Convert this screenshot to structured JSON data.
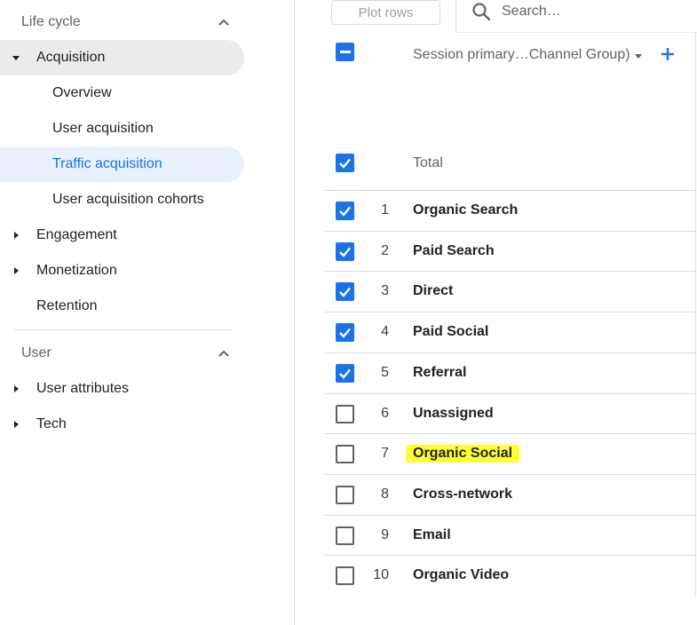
{
  "sidebar": {
    "lifecycle_header": "Life cycle",
    "acquisition": "Acquisition",
    "acquisition_items": [
      "Overview",
      "User acquisition",
      "Traffic acquisition",
      "User acquisition cohorts"
    ],
    "engagement": "Engagement",
    "monetization": "Monetization",
    "retention": "Retention",
    "user_header": "User",
    "user_attributes": "User attributes",
    "tech": "Tech",
    "selected_item": "Traffic acquisition"
  },
  "toolbar": {
    "plot_rows_label": "Plot rows",
    "search_placeholder": "Search…"
  },
  "table": {
    "dimension_label": "Session primary…Channel Group)",
    "total_label": "Total",
    "rows": [
      {
        "num": "1",
        "name": "Organic Search",
        "checked": true
      },
      {
        "num": "2",
        "name": "Paid Search",
        "checked": true
      },
      {
        "num": "3",
        "name": "Direct",
        "checked": true
      },
      {
        "num": "4",
        "name": "Paid Social",
        "checked": true
      },
      {
        "num": "5",
        "name": "Referral",
        "checked": true
      },
      {
        "num": "6",
        "name": "Unassigned",
        "checked": false
      },
      {
        "num": "7",
        "name": "Organic Social",
        "checked": false,
        "highlighted": true
      },
      {
        "num": "8",
        "name": "Cross-network",
        "checked": false
      },
      {
        "num": "9",
        "name": "Email",
        "checked": false
      },
      {
        "num": "10",
        "name": "Organic Video",
        "checked": false
      }
    ]
  },
  "colors": {
    "accent": "#1a73e8",
    "selected_bg": "#e8f0fe",
    "highlight": "#ffff33"
  }
}
